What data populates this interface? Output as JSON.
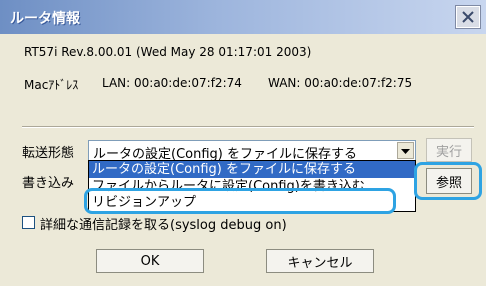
{
  "window": {
    "title": "ルータ情報",
    "icons": {
      "close": "close-icon",
      "dropdown": "chevron-down-icon"
    },
    "colors": {
      "highlight": "#2ea3e3",
      "selection": "#316ac5"
    }
  },
  "info": {
    "version_line": "RT57i Rev.8.00.01 (Wed May 28 01:17:01 2003)",
    "mac_label": "Macｱﾄﾞﾚｽ",
    "lan": "LAN: 00:a0:de:07:f2:74",
    "wan": "WAN: 00:a0:de:07:f2:75"
  },
  "transfer": {
    "label": "転送形態",
    "selected": "ルータの設定(Config) をファイルに保存する",
    "options": [
      "ルータの設定(Config) をファイルに保存する",
      "ファイルからルータに設定(Config)を書き込む",
      "リビジョンアップ"
    ],
    "execute_label": "実行"
  },
  "write": {
    "label": "書き込み",
    "browse_label": "参照"
  },
  "detail_log": {
    "label": "詳細な通信記録を取る(syslog debug on)",
    "checked": false
  },
  "buttons": {
    "ok": "OK",
    "cancel": "キャンセル"
  }
}
